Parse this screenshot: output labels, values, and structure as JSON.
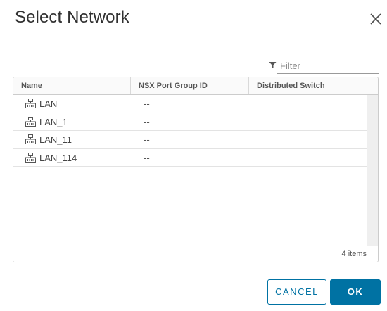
{
  "dialog": {
    "title": "Select Network",
    "close_icon": "close-icon"
  },
  "filter": {
    "placeholder": "Filter",
    "icon": "filter-icon"
  },
  "grid": {
    "columns": [
      "Name",
      "NSX Port Group ID",
      "Distributed Switch"
    ],
    "rows": [
      {
        "icon": "network-icon",
        "name": "LAN",
        "nsx_port_group_id": "--",
        "distributed_switch": ""
      },
      {
        "icon": "network-icon",
        "name": "LAN_1",
        "nsx_port_group_id": "--",
        "distributed_switch": ""
      },
      {
        "icon": "network-icon",
        "name": "LAN_11",
        "nsx_port_group_id": "--",
        "distributed_switch": ""
      },
      {
        "icon": "network-icon",
        "name": "LAN_114",
        "nsx_port_group_id": "--",
        "distributed_switch": ""
      }
    ],
    "footer": "4 items"
  },
  "buttons": {
    "cancel": "CANCEL",
    "ok": "OK"
  },
  "colors": {
    "primary": "#0072a3",
    "border": "#cccccc",
    "title": "#313131"
  }
}
